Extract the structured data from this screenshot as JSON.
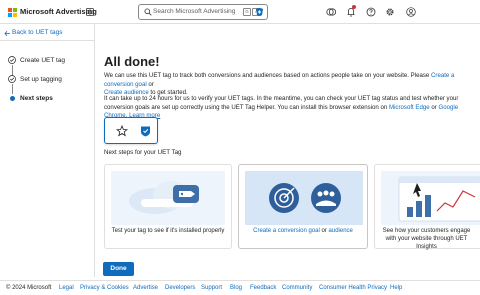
{
  "header": {
    "brand": "Microsoft Advertising",
    "search_placeholder": "Search Microsoft Advertising",
    "search_keys": [
      "G",
      "/"
    ],
    "icons": [
      "apps-grid-icon",
      "search-icon",
      "copilot-icon",
      "accounts-icon",
      "notifications-bell-icon",
      "help-icon",
      "settings-gear-icon",
      "profile-avatar-icon"
    ]
  },
  "sidebar": {
    "back_link": "Back to UET tags",
    "steps": [
      {
        "label": "Create UET tag",
        "state": "completed"
      },
      {
        "label": "Set up tagging",
        "state": "completed"
      },
      {
        "label": "Next steps",
        "state": "current"
      }
    ]
  },
  "main": {
    "title": "All done!",
    "para1": {
      "text": "We can use this UET tag to track both conversions and audiences based on actions people take on your website. Please",
      "link1": "Create a conversion goal",
      "or": "or",
      "link2": "Create audience",
      "end": "to get started."
    },
    "para2": {
      "text": "It can take up to 24 hours for us to verify your UET tags. In the meantime, you can check your UET tag status and test whether your conversion goals are set up correctly using the UET Tag Helper. You can install this browser extension on",
      "edge": "Microsoft Edge",
      "or": "or",
      "chrome": "Google Chrome.",
      "learn": "Learn more"
    },
    "next_steps_label": "Next steps for your UET Tag",
    "cards": [
      {
        "caption": "Test your tag to see if it's installed properly"
      },
      {
        "caption_link1": "Create a conversion goal",
        "caption_or": "or",
        "caption_link2": "audience"
      },
      {
        "caption": "See how your customers engage with your website through UET Insights"
      }
    ],
    "done_button": "Done"
  },
  "footer": {
    "copyright": "© 2024 Microsoft",
    "links": [
      "Legal",
      "Privacy & Cookies",
      "Advertise",
      "Developers",
      "Support",
      "Blog",
      "Feedback",
      "Community",
      "Consumer Health Privacy",
      "Help"
    ]
  },
  "colors": {
    "accent": "#0f6cbd",
    "notification": "#d13438",
    "logo": [
      "#f25022",
      "#7fba00",
      "#00a4ef",
      "#ffb900"
    ]
  }
}
